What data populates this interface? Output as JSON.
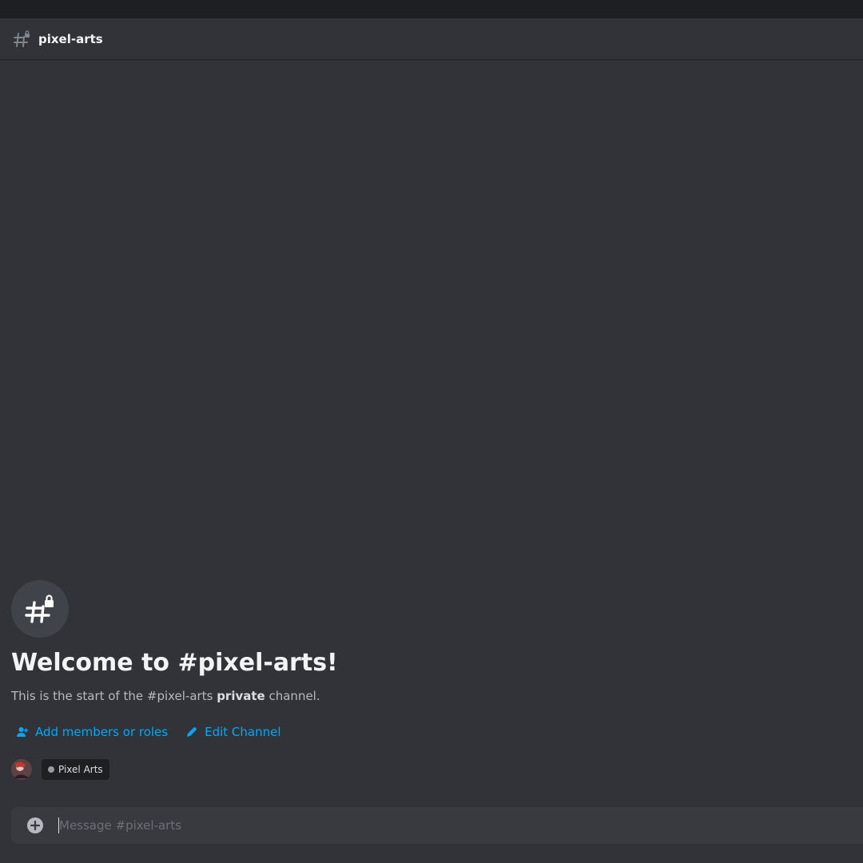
{
  "header": {
    "channel_name": "pixel-arts"
  },
  "welcome": {
    "title": "Welcome to #pixel-arts!",
    "desc_prefix": "This is the start of the #pixel-arts ",
    "desc_bold": "private",
    "desc_suffix": " channel."
  },
  "actions": {
    "add_members": "Add members or roles",
    "edit_channel": "Edit Channel"
  },
  "role": {
    "label": "Pixel Arts"
  },
  "composer": {
    "placeholder": "Message #pixel-arts",
    "value": ""
  },
  "colors": {
    "background": "#313338",
    "link": "#00a8fc",
    "composer": "#383a40"
  }
}
